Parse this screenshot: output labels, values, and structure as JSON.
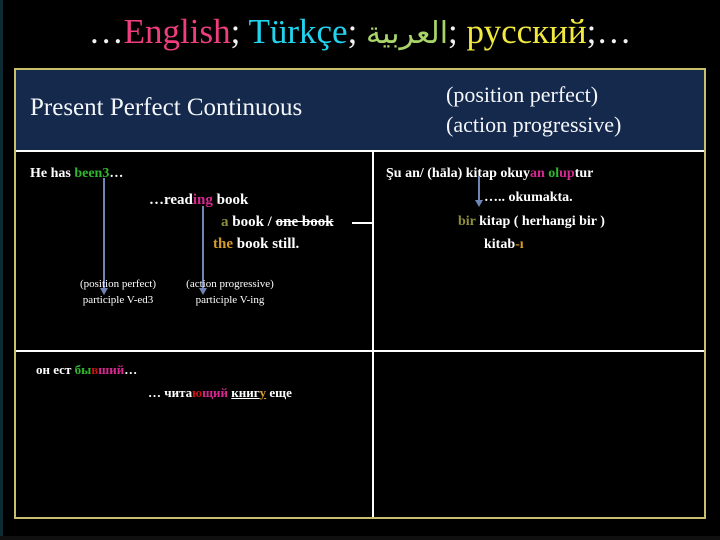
{
  "banner": {
    "leading_dots": "…",
    "languages": [
      {
        "name": "English",
        "color": "#ef3d7e"
      },
      {
        "name": "Türkçe",
        "color": "#22d3ee"
      },
      {
        "name": "العربية",
        "color": "#a9d46a"
      },
      {
        "name": "русский",
        "color": "#f2e93f"
      }
    ],
    "separator": ";",
    "trailing_dots": "…"
  },
  "table": {
    "header": {
      "title": "Present Perfect Continuous",
      "subtitle_line1": "(position perfect)",
      "subtitle_line2": "(action progressive)"
    },
    "english": {
      "line1": {
        "plain": "He has ",
        "colored": "been3",
        "suffix": "…"
      },
      "line2": {
        "prefix": "…read",
        "highlight": "ing",
        "suffix": "  book"
      },
      "line3": {
        "article": "a",
        "noun": " book / ",
        "struck": "one book"
      },
      "line4": {
        "article": "the",
        "noun": " book ",
        "tail": "  still."
      },
      "label_position": "(position perfect)",
      "label_action": "(action progressive)",
      "participle_ed": "participle V-ed3",
      "participle_ing": "participle V-ing"
    },
    "turkish": {
      "line1": {
        "prefix": "Şu an/ (hāla)  kitap  okuy",
        "suffix_an": "an",
        "gap": "  ",
        "ol": "ol",
        "up": "up",
        "tur": "tur"
      },
      "line2": "….. okumakta.",
      "line3": {
        "bir": "bir",
        "rest": " kitap ( herhangi bir )"
      },
      "line4": {
        "stem": "kitab",
        "suffix": "-ı"
      }
    },
    "russian": {
      "line1": {
        "plain": "он   ест   ",
        "g1": "бы",
        "g2": "в",
        "g3": "ший",
        "dots": "…"
      },
      "line2": {
        "dots": "… ",
        "stem": "чита",
        "r1": "ю",
        "r2": "щий",
        "gap": "   ",
        "noun": "книг",
        "noun_suffix": "у",
        "tail": " еще"
      }
    }
  },
  "colors": {
    "frame_border": "#c8bf6a",
    "header_bg": "#14294b",
    "grid_line": "#ffffff",
    "arrow": "#6f86b5",
    "green": "#2eb82e",
    "magenta": "#d6268f",
    "olive": "#8f8f3a",
    "gold": "#d79b2a",
    "red": "#cc1111"
  }
}
